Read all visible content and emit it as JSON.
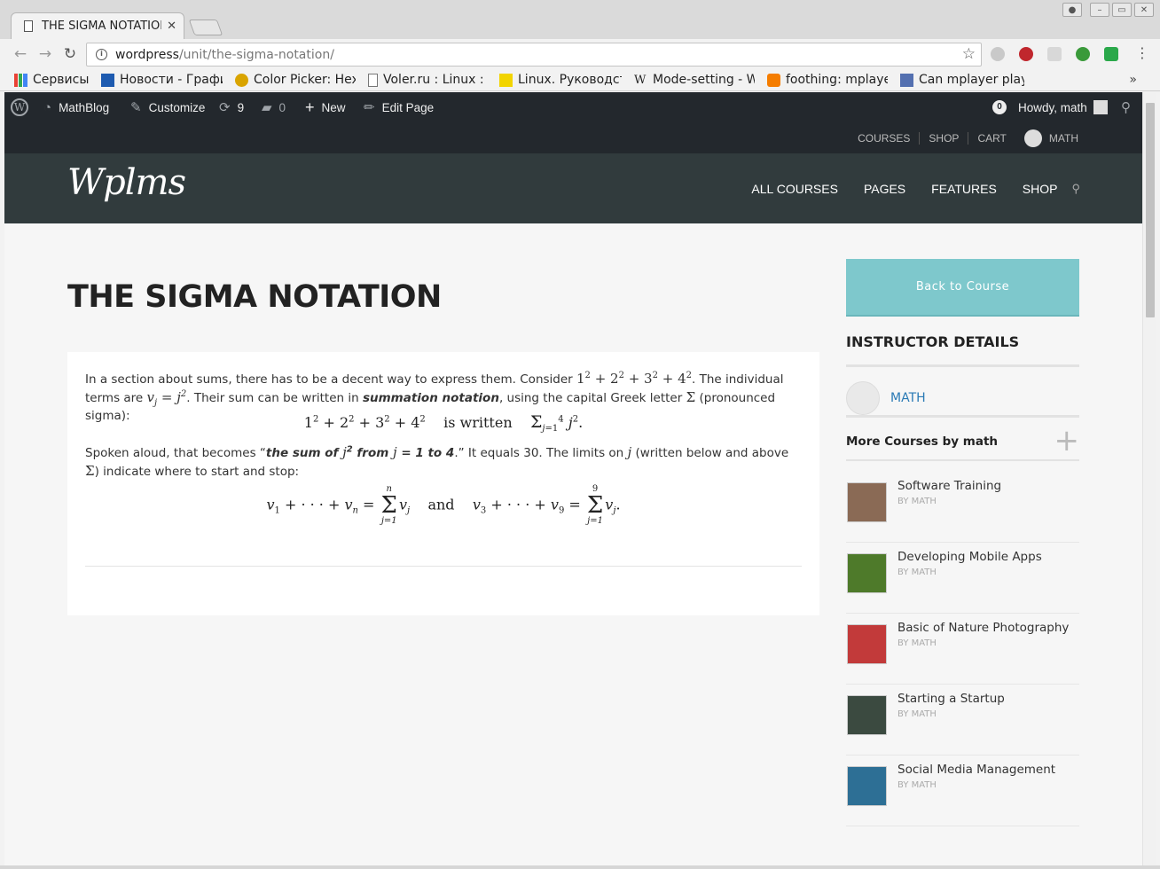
{
  "browser": {
    "tab_title": "THE SIGMA NOTATION",
    "url_host": "wordpress",
    "url_path": "/unit/the-sigma-notation/",
    "bookmarks": [
      {
        "label": "Сервисы",
        "icon": "apps-grid-icon",
        "color": "#4285f4"
      },
      {
        "label": "Новости - Графи",
        "icon": "bookmark-favicon-icon",
        "color": "#1e5bb0"
      },
      {
        "label": "Color Picker: Hex",
        "icon": "bookmark-favicon-icon",
        "color": "#d9a400"
      },
      {
        "label": "Voler.ru : Linux : Н",
        "icon": "page-icon",
        "color": "#777777"
      },
      {
        "label": "Linux. Руководст",
        "icon": "bookmark-favicon-icon",
        "color": "#f2d400"
      },
      {
        "label": "Mode-setting - W",
        "icon": "wikipedia-icon",
        "color": "#333333"
      },
      {
        "label": "foothing: mplaye",
        "icon": "blogger-icon",
        "color": "#f57d00"
      },
      {
        "label": "Can mplayer play",
        "icon": "bookmark-favicon-icon",
        "color": "#5470b0"
      }
    ]
  },
  "adminbar": {
    "site": "MathBlog",
    "customize": "Customize",
    "updates": "9",
    "comments": "0",
    "new": "New",
    "edit": "Edit Page",
    "notifications": "0",
    "howdy": "Howdy, math"
  },
  "toplinks": {
    "courses": "COURSES",
    "shop": "SHOP",
    "cart": "CART",
    "user": "MATH"
  },
  "header": {
    "logo": "Wplms",
    "nav": [
      "ALL COURSES",
      "PAGES",
      "FEATURES",
      "SHOP"
    ]
  },
  "page": {
    "title": "THE SIGMA NOTATION",
    "p1_a": "In a section about sums, there has to be a decent way to express them. Consider ",
    "p1_b": ". The individual terms are ",
    "p1_c": ". Their sum can be written in ",
    "p1_em": "summation notation",
    "p1_d": ", using the capital Greek letter ",
    "p1_e": " (pronounced sigma):",
    "display1_text": "is written",
    "p2_a": "Spoken aloud, that becomes “",
    "p2_em1": "the sum of ",
    "p2_em2": " from ",
    "p2_em3": " to 4",
    "p2_b": ".” It equals 30. The limits on ",
    "p2_c": " (written below and above ",
    "p2_d": ") indicate where to start and stop:",
    "display2_and": "and"
  },
  "sidebar": {
    "back_button": "Back to Course",
    "instructor_heading": "INSTRUCTOR DETAILS",
    "instructor_name": "MATH",
    "more_heading": "More Courses by math",
    "courses": [
      {
        "title": "Software Training",
        "by": "BY MATH",
        "thumb_color": "#8a6a55"
      },
      {
        "title": "Developing Mobile Apps",
        "by": "BY MATH",
        "thumb_color": "#4e7a2a"
      },
      {
        "title": "Basic of Nature Photography",
        "by": "BY MATH",
        "thumb_color": "#c23a3a"
      },
      {
        "title": "Starting a Startup",
        "by": "BY MATH",
        "thumb_color": "#3b4a40"
      },
      {
        "title": "Social Media Management",
        "by": "BY MATH",
        "thumb_color": "#2d6f95"
      }
    ]
  },
  "colors": {
    "adminbar_bg": "#23282d",
    "header_bg": "#313b3d",
    "accent_button": "#7ec8cc",
    "link": "#2a7ab5"
  }
}
